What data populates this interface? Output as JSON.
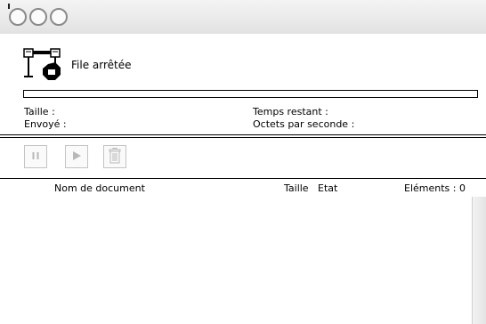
{
  "window": {
    "controls": [
      "close-button",
      "minimize-button",
      "zoom-button"
    ]
  },
  "queue": {
    "status": "File arrêtée",
    "progress": 0
  },
  "info": {
    "size_label": "Taille :",
    "sent_label": "Envoyé :",
    "time_remaining_label": "Temps restant :",
    "bytes_per_second_label": "Octets par seconde :"
  },
  "toolbar": {
    "pause_icon": "pause-icon",
    "play_icon": "play-icon",
    "trash_icon": "trash-icon"
  },
  "list": {
    "columns": {
      "name": "Nom de document",
      "size": "Taille",
      "status": "Etat",
      "elements": "Eléments : 0"
    },
    "rows": []
  }
}
